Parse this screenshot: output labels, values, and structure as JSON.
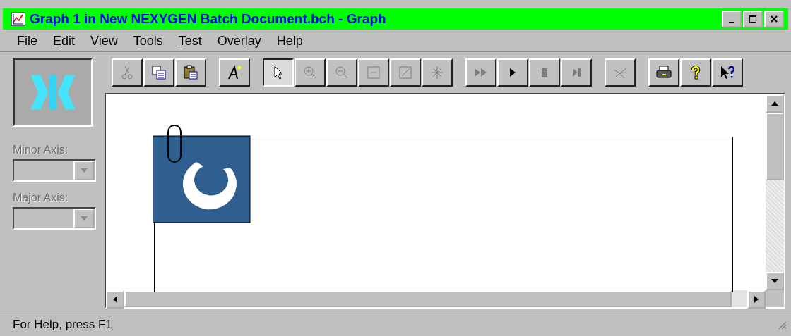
{
  "window": {
    "title": "Graph 1 in New NEXYGEN Batch Document.bch - Graph"
  },
  "menu": [
    {
      "key": "F",
      "post": "ile"
    },
    {
      "key": "E",
      "post": "dit"
    },
    {
      "key": "V",
      "post": "iew"
    },
    {
      "pre": "T",
      "key": "o",
      "post": "ols"
    },
    {
      "key": "T",
      "post": "est"
    },
    {
      "pre": "Over",
      "key": "l",
      "post": "ay"
    },
    {
      "key": "H",
      "post": "elp"
    }
  ],
  "toolbar": [
    [
      {
        "kind": "cut",
        "disabled": true,
        "pressed": false
      },
      {
        "kind": "copy",
        "disabled": false,
        "pressed": false
      },
      {
        "kind": "paste",
        "disabled": false,
        "pressed": false
      }
    ],
    [
      {
        "kind": "font",
        "disabled": false,
        "pressed": false
      }
    ],
    [
      {
        "kind": "pointer",
        "disabled": false,
        "pressed": true
      },
      {
        "kind": "zoom-in",
        "disabled": true,
        "pressed": false
      },
      {
        "kind": "zoom-out",
        "disabled": true,
        "pressed": false
      },
      {
        "kind": "minus-box",
        "disabled": true,
        "pressed": false
      },
      {
        "kind": "slash-box",
        "disabled": true,
        "pressed": false
      },
      {
        "kind": "burst",
        "disabled": true,
        "pressed": false
      }
    ],
    [
      {
        "kind": "fast-forward",
        "disabled": true,
        "pressed": false
      },
      {
        "kind": "play",
        "disabled": false,
        "pressed": false
      },
      {
        "kind": "stop",
        "disabled": true,
        "pressed": false
      },
      {
        "kind": "step",
        "disabled": true,
        "pressed": false
      }
    ],
    [
      {
        "kind": "scatter",
        "disabled": true,
        "pressed": false
      }
    ],
    [
      {
        "kind": "print",
        "disabled": false,
        "pressed": false
      },
      {
        "kind": "help",
        "disabled": false,
        "pressed": false
      },
      {
        "kind": "context-help",
        "disabled": false,
        "pressed": false
      }
    ]
  ],
  "side_panel": {
    "axes": [
      {
        "label": "Minor Axis:",
        "disabled": true
      },
      {
        "label": "Major Axis:",
        "disabled": true
      }
    ]
  },
  "status_bar": {
    "text": "For Help, press F1"
  }
}
